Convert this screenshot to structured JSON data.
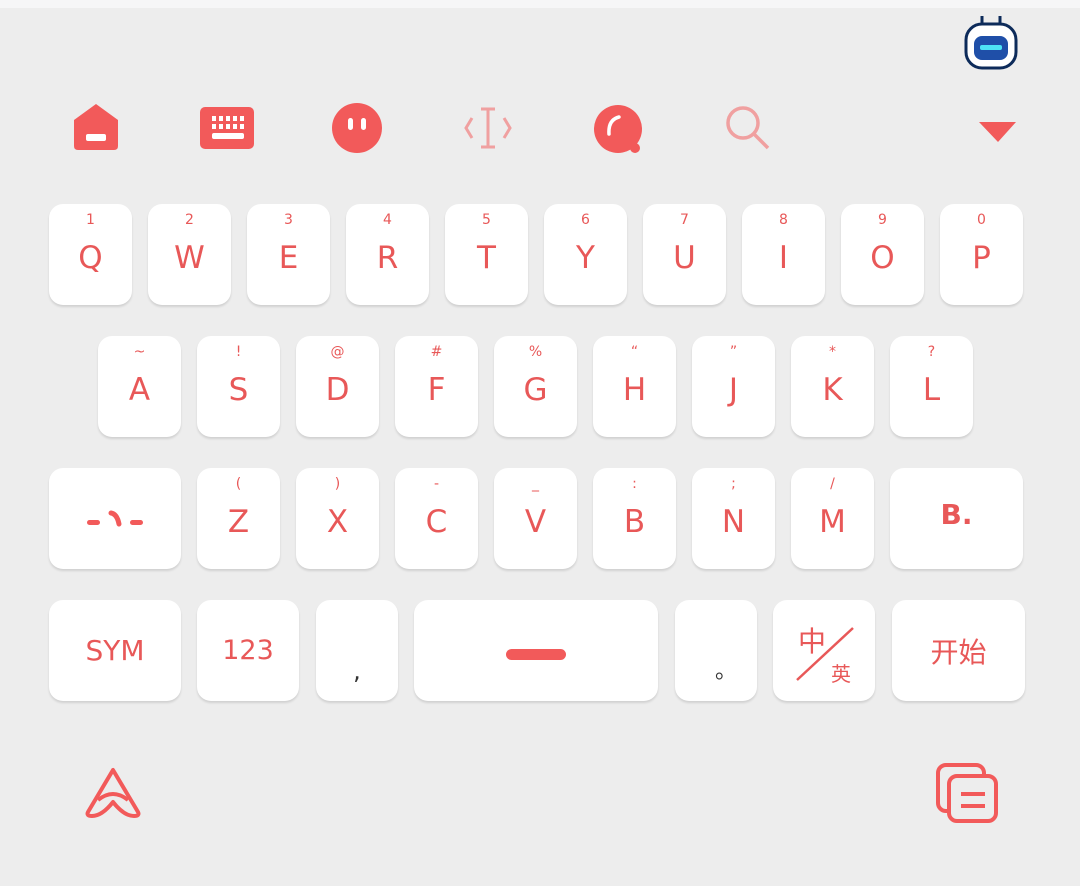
{
  "colors": {
    "accent": "#f25a5a",
    "background": "#ededed",
    "key": "#ffffff"
  },
  "toolbar": {
    "icons": [
      "home-icon",
      "keyboard-icon",
      "emoji-face-icon",
      "cursor-move-icon",
      "bubble-icon",
      "search-icon",
      "collapse-down-icon"
    ],
    "assistant": "robot-assistant-icon"
  },
  "rows": [
    [
      {
        "main": "Q",
        "sub": "1"
      },
      {
        "main": "W",
        "sub": "2"
      },
      {
        "main": "E",
        "sub": "3"
      },
      {
        "main": "R",
        "sub": "4"
      },
      {
        "main": "T",
        "sub": "5"
      },
      {
        "main": "Y",
        "sub": "6"
      },
      {
        "main": "U",
        "sub": "7"
      },
      {
        "main": "I",
        "sub": "8"
      },
      {
        "main": "O",
        "sub": "9"
      },
      {
        "main": "P",
        "sub": "0"
      }
    ],
    [
      {
        "main": "A",
        "sub": "~"
      },
      {
        "main": "S",
        "sub": "!"
      },
      {
        "main": "D",
        "sub": "@"
      },
      {
        "main": "F",
        "sub": "#"
      },
      {
        "main": "G",
        "sub": "%"
      },
      {
        "main": "H",
        "sub": "“"
      },
      {
        "main": "J",
        "sub": "”"
      },
      {
        "main": "K",
        "sub": "*"
      },
      {
        "main": "L",
        "sub": "?"
      }
    ],
    [
      {
        "main": "Z",
        "sub": "("
      },
      {
        "main": "X",
        "sub": ")"
      },
      {
        "main": "C",
        "sub": "-"
      },
      {
        "main": "V",
        "sub": "_"
      },
      {
        "main": "B",
        "sub": ":"
      },
      {
        "main": "N",
        "sub": ";"
      },
      {
        "main": "M",
        "sub": "/"
      }
    ]
  ],
  "keys": {
    "shift": "shift-icon",
    "backspace": "B.",
    "sym": "SYM",
    "num": "123",
    "comma": ",",
    "period": "。",
    "lang_cn": "中",
    "lang_en": "英",
    "enter": "开始"
  },
  "bottom": {
    "logo": "app-logo-icon",
    "clipboard": "clipboard-icon"
  }
}
